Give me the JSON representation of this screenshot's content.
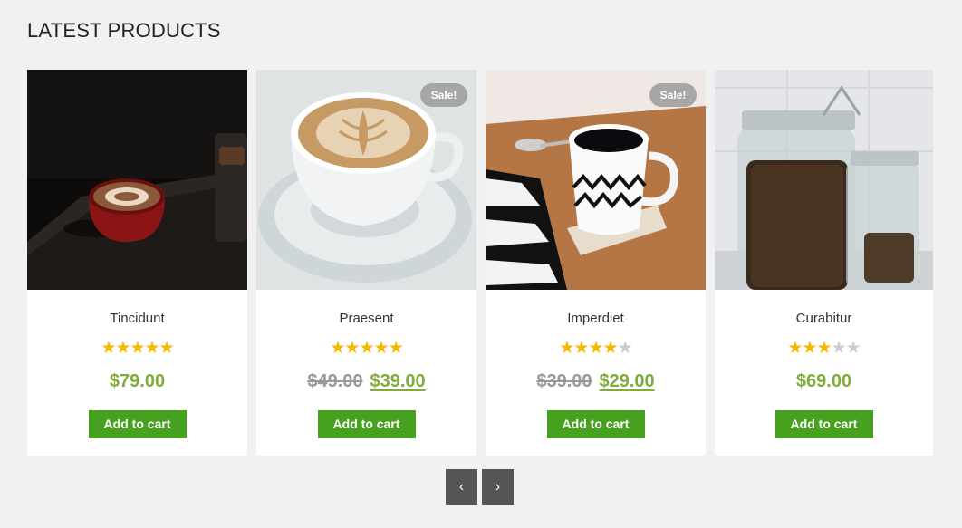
{
  "section": {
    "title": "LATEST PRODUCTS"
  },
  "products": [
    {
      "name": "Tincidunt",
      "rating": 5,
      "max_rating": 5,
      "price": "$79.00",
      "old_price": null,
      "sale": null,
      "button": "Add to cart",
      "image": "latte-art-dark"
    },
    {
      "name": "Praesent",
      "rating": 5,
      "max_rating": 5,
      "price": "$39.00",
      "old_price": "$49.00",
      "sale": "Sale!",
      "button": "Add to cart",
      "image": "cappuccino-saucer"
    },
    {
      "name": "Imperdiet",
      "rating": 4,
      "max_rating": 5,
      "price": "$29.00",
      "old_price": "$39.00",
      "sale": "Sale!",
      "button": "Add to cart",
      "image": "black-coffee-zigzag"
    },
    {
      "name": "Curabitur",
      "rating": 3,
      "max_rating": 5,
      "price": "$69.00",
      "old_price": null,
      "sale": null,
      "button": "Add to cart",
      "image": "coffee-bean-jars"
    }
  ],
  "pager": {
    "prev": "‹",
    "next": "›"
  },
  "colors": {
    "accent_green": "#46a21e",
    "price_green": "#7fad39",
    "star": "#f5b800",
    "background": "#f1f1f1"
  }
}
